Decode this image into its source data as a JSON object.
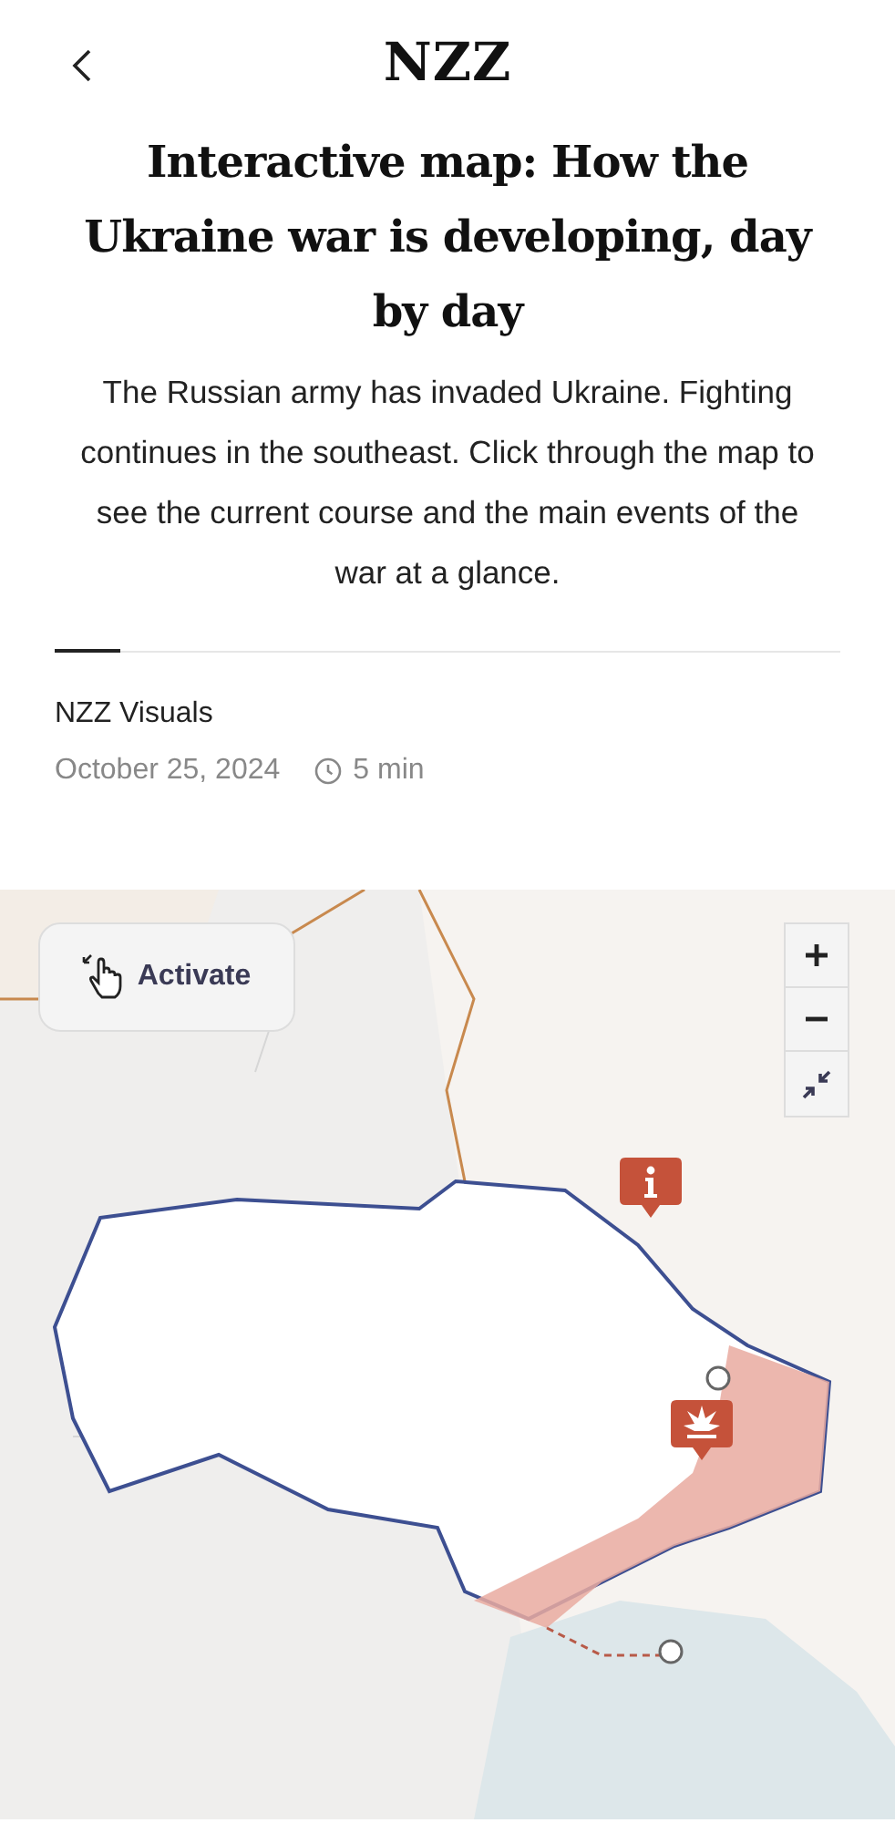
{
  "header": {
    "logo": "NZZ"
  },
  "article": {
    "title": "Interactive map: How the Ukraine war is developing, day by day",
    "lead": "The Russian army has invaded Ukraine. Fighting continues in the southeast. Click through the map to see the current course and the main events of the war at a glance.",
    "author": "NZZ Visuals",
    "date": "October 25, 2024",
    "reading_time": "5 min"
  },
  "map": {
    "kind": "picture",
    "activate_button": "Activate",
    "markers": [
      {
        "kind": "info"
      },
      {
        "kind": "explosion"
      }
    ]
  }
}
